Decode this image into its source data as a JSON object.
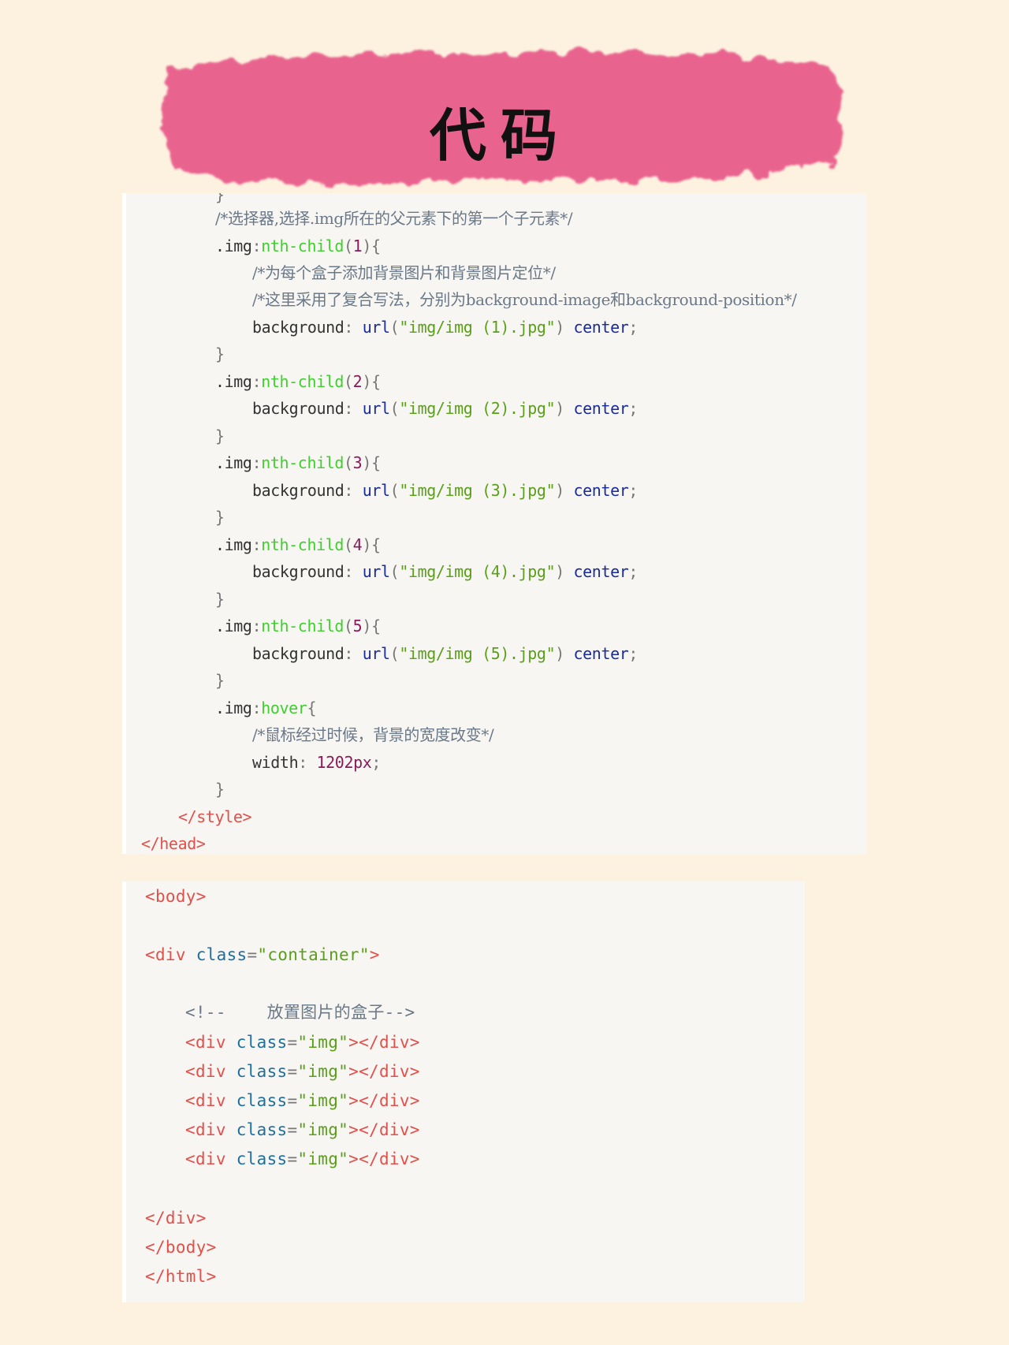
{
  "title": "代码",
  "colors": {
    "page_background": "#fdf2df",
    "banner": "#e9638f",
    "code_background": "#f7f6f2",
    "tag": "#e2504b",
    "attribute": "#1f6f9d",
    "string": "#5a9e1a",
    "pseudo_class": "#3fcf2f",
    "number": "#8b1a5a",
    "comment": "#6a7888"
  },
  "css_block": {
    "top_brace": "}",
    "comment_selector": "/*选择器,选择.img所在的父元素下的第一个子元素*/",
    "rules": [
      {
        "selector": ".img",
        "pseudo": "nth-child",
        "arg": "1",
        "comments": [
          "/*为每个盒子添加背景图片和背景图片定位*/",
          "/*这里采用了复合写法，分别为background-image和background-position*/"
        ],
        "property": "background",
        "fn": "url",
        "url": "\"img/img (1).jpg\"",
        "keyword": "center"
      },
      {
        "selector": ".img",
        "pseudo": "nth-child",
        "arg": "2",
        "property": "background",
        "fn": "url",
        "url": "\"img/img (2).jpg\"",
        "keyword": "center"
      },
      {
        "selector": ".img",
        "pseudo": "nth-child",
        "arg": "3",
        "property": "background",
        "fn": "url",
        "url": "\"img/img (3).jpg\"",
        "keyword": "center"
      },
      {
        "selector": ".img",
        "pseudo": "nth-child",
        "arg": "4",
        "property": "background",
        "fn": "url",
        "url": "\"img/img (4).jpg\"",
        "keyword": "center"
      },
      {
        "selector": ".img",
        "pseudo": "nth-child",
        "arg": "5",
        "property": "background",
        "fn": "url",
        "url": "\"img/img (5).jpg\"",
        "keyword": "center"
      }
    ],
    "hover_rule": {
      "selector": ".img",
      "pseudo": "hover",
      "comment": "/*鼠标经过时候，背景的宽度改变*/",
      "property": "width",
      "value": "1202px"
    },
    "close_style": "</style>",
    "close_head": "</head>"
  },
  "html_block": {
    "body_open": "<body>",
    "container_tag": "<div",
    "container_attr": "class",
    "container_value": "\"container\"",
    "comment_open": "<!--",
    "comment_text": "放置图片的盒子",
    "comment_close": "-->",
    "img_divs": [
      {
        "open": "<div",
        "attr": "class",
        "value": "\"img\"",
        "close": "></div>"
      },
      {
        "open": "<div",
        "attr": "class",
        "value": "\"img\"",
        "close": "></div>"
      },
      {
        "open": "<div",
        "attr": "class",
        "value": "\"img\"",
        "close": "></div>"
      },
      {
        "open": "<div",
        "attr": "class",
        "value": "\"img\"",
        "close": "></div>"
      },
      {
        "open": "<div",
        "attr": "class",
        "value": "\"img\"",
        "close": "></div>"
      }
    ],
    "div_close": "</div>",
    "body_close": "</body>",
    "html_close": "</html>"
  }
}
